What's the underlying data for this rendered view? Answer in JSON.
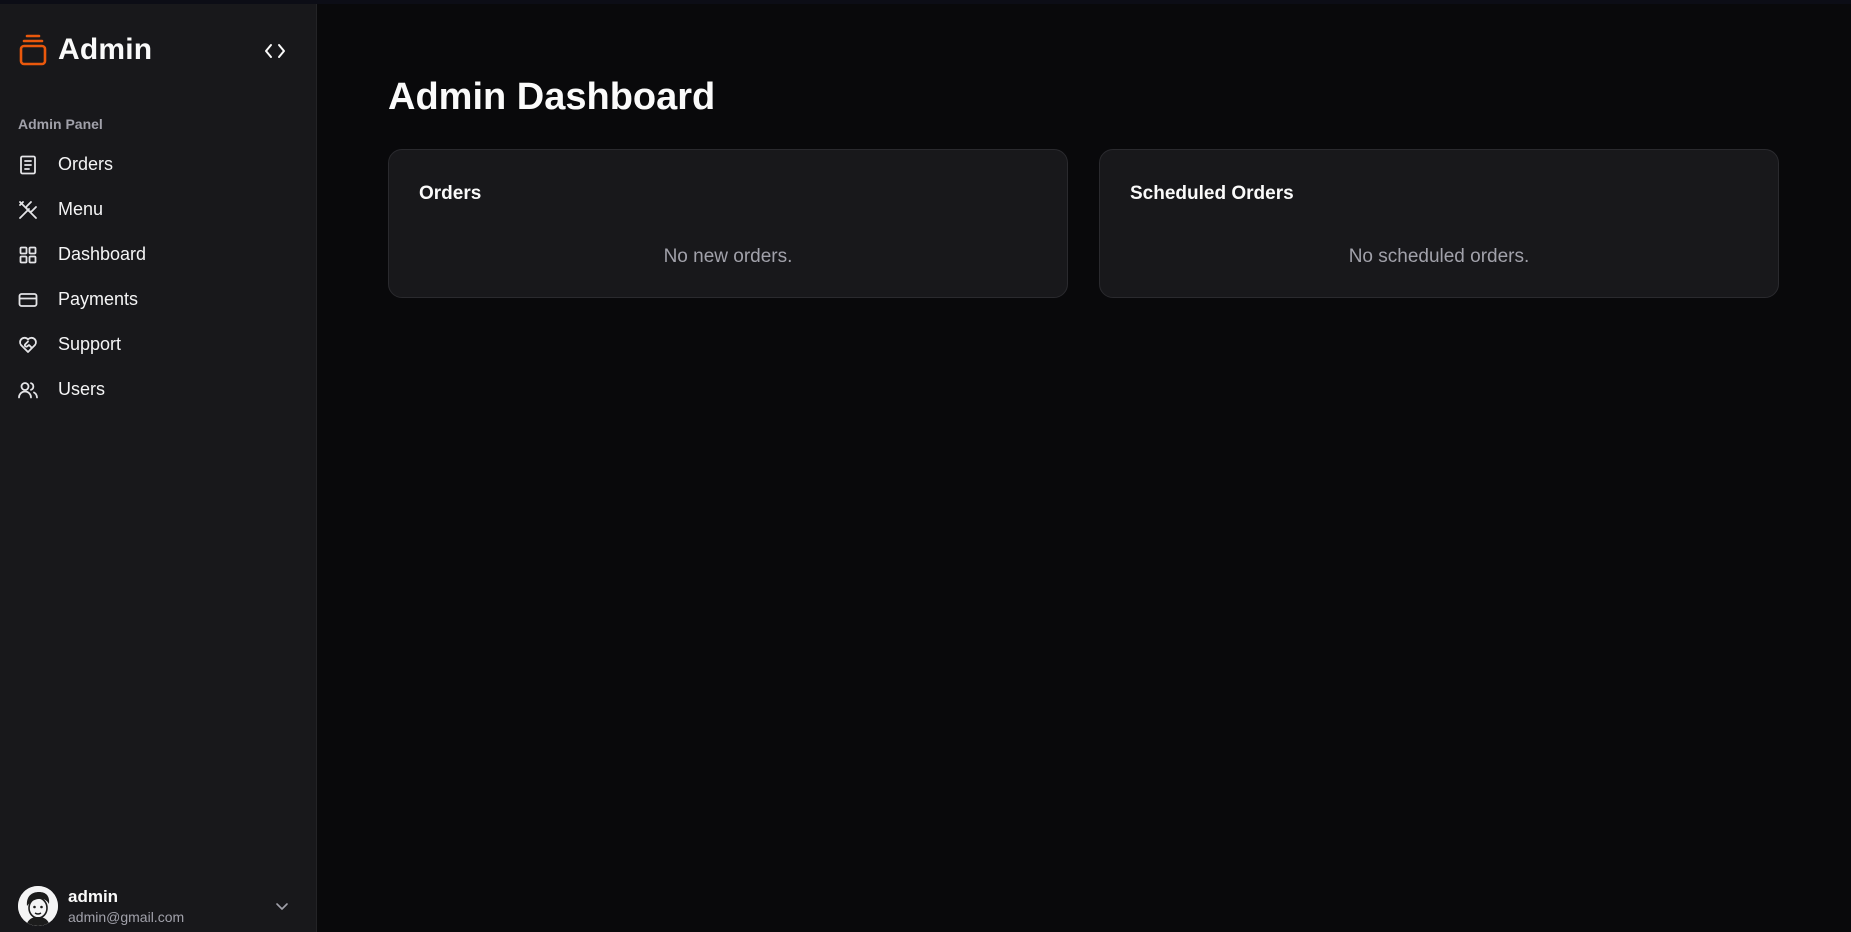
{
  "sidebar": {
    "brand": {
      "name": "Admin",
      "icon": "stacked-tray-icon",
      "accent_color": "#ea580c"
    },
    "collapse_icon": "code-brackets-icon",
    "section_label": "Admin Panel",
    "items": [
      {
        "label": "Orders",
        "icon": "receipt-icon"
      },
      {
        "label": "Menu",
        "icon": "utensils-crossed-icon"
      },
      {
        "label": "Dashboard",
        "icon": "layout-grid-icon"
      },
      {
        "label": "Payments",
        "icon": "credit-card-icon"
      },
      {
        "label": "Support",
        "icon": "heart-handshake-icon"
      },
      {
        "label": "Users",
        "icon": "users-icon"
      }
    ],
    "user": {
      "name": "admin",
      "email": "admin@gmail.com",
      "avatar_icon": "cartoon-avatar",
      "menu_icon": "chevron-down-icon"
    }
  },
  "main": {
    "title": "Admin Dashboard",
    "cards": [
      {
        "title": "Orders",
        "empty_text": "No new orders."
      },
      {
        "title": "Scheduled Orders",
        "empty_text": "No scheduled orders."
      }
    ]
  }
}
